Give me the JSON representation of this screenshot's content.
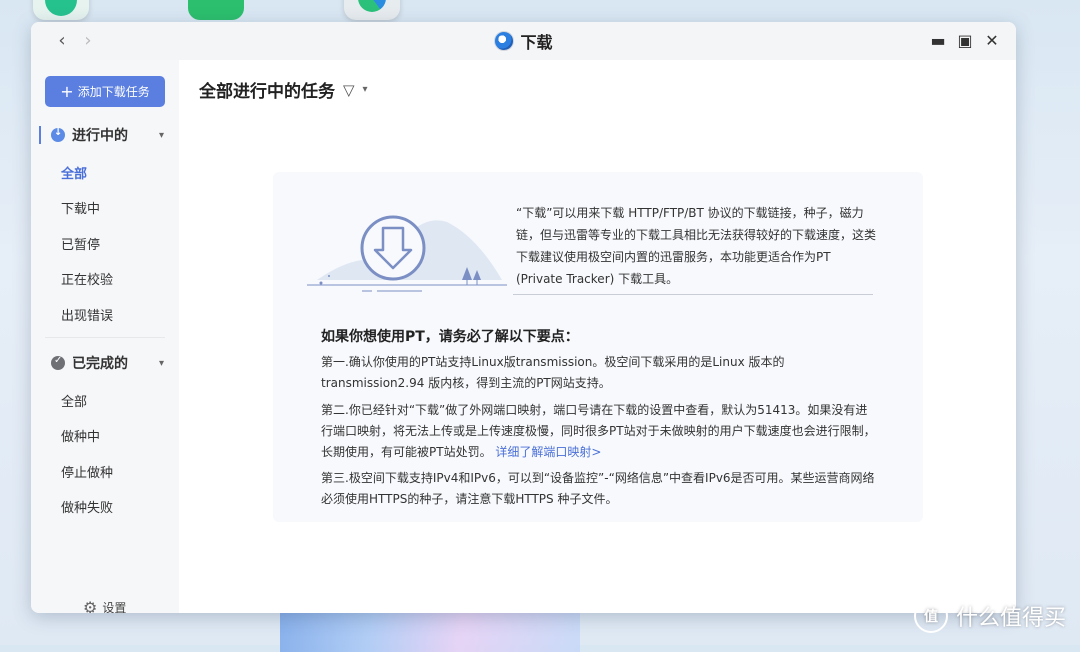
{
  "window": {
    "title": "下载"
  },
  "sidebar": {
    "add_task_label": "添加下载任务",
    "groups": [
      {
        "label": "进行中的",
        "items": [
          "全部",
          "下载中",
          "已暂停",
          "正在校验",
          "出现错误"
        ]
      },
      {
        "label": "已完成的",
        "items": [
          "全部",
          "做种中",
          "停止做种",
          "做种失败"
        ]
      }
    ],
    "settings_label": "设置"
  },
  "main": {
    "title": "全部进行中的任务",
    "intro": "“下载”可以用来下载 HTTP/FTP/BT 协议的下载链接，种子，磁力链，但与迅雷等专业的下载工具相比无法获得较好的下载速度，这类下载建议使用极空间内置的迅雷服务，本功能更适合作为PT (Private Tracker) 下载工具。",
    "tips_title": "如果你想使用PT，请务必了解以下要点：",
    "tip1": "第一.确认你使用的PT站支持Linux版transmission。极空间下载采用的是Linux 版本的 transmission2.94 版内核，得到主流的PT网站支持。",
    "tip2": "第二.你已经针对“下载”做了外网端口映射，端口号请在下载的设置中查看，默认为51413。如果没有进行端口映射，将无法上传或是上传速度极慢，同时很多PT站对于未做映射的用户下载速度也会进行限制，长期使用，有可能被PT站处罚。",
    "tip2_link": "详细了解端口映射>",
    "tip3": "第三.极空间下载支持IPv4和IPv6，可以到“设备监控”-“网络信息”中查看IPv6是否可用。某些运营商网络必须使用HTTPS的种子，请注意下载HTTPS 种子文件。"
  },
  "watermark": {
    "text": "什么值得买",
    "logo_char": "值"
  },
  "colors": {
    "accent": "#5b7fe0",
    "link": "#4a6fd8"
  }
}
